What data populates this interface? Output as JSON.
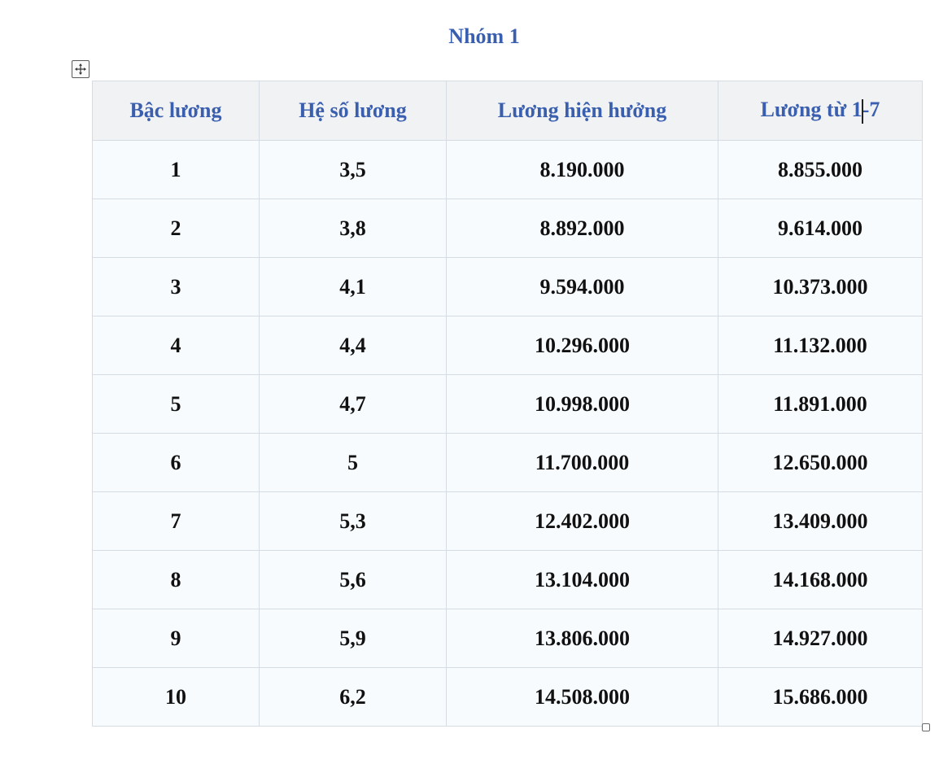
{
  "document": {
    "title": "Nhóm 1"
  },
  "table": {
    "headers": [
      "Bậc lương",
      "Hệ số lương",
      "Lương hiện hưởng",
      "Lương từ 1-7"
    ],
    "rows": [
      [
        "1",
        "3,5",
        "8.190.000",
        "8.855.000"
      ],
      [
        "2",
        "3,8",
        "8.892.000",
        "9.614.000"
      ],
      [
        "3",
        "4,1",
        "9.594.000",
        "10.373.000"
      ],
      [
        "4",
        "4,4",
        "10.296.000",
        "11.132.000"
      ],
      [
        "5",
        "4,7",
        "10.998.000",
        "11.891.000"
      ],
      [
        "6",
        "5",
        "11.700.000",
        "12.650.000"
      ],
      [
        "7",
        "5,3",
        "12.402.000",
        "13.409.000"
      ],
      [
        "8",
        "5,6",
        "13.104.000",
        "14.168.000"
      ],
      [
        "9",
        "5,9",
        "13.806.000",
        "14.927.000"
      ],
      [
        "10",
        "6,2",
        "14.508.000",
        "15.686.000"
      ]
    ]
  },
  "colors": {
    "heading_blue": "#3a5fae",
    "header_bg": "#f1f2f4",
    "cell_bg": "#f8fbfd",
    "border": "#d6dce4"
  },
  "icons": {
    "move_handle": "move-arrows-icon",
    "resize_handle": "resize-handle-icon"
  }
}
